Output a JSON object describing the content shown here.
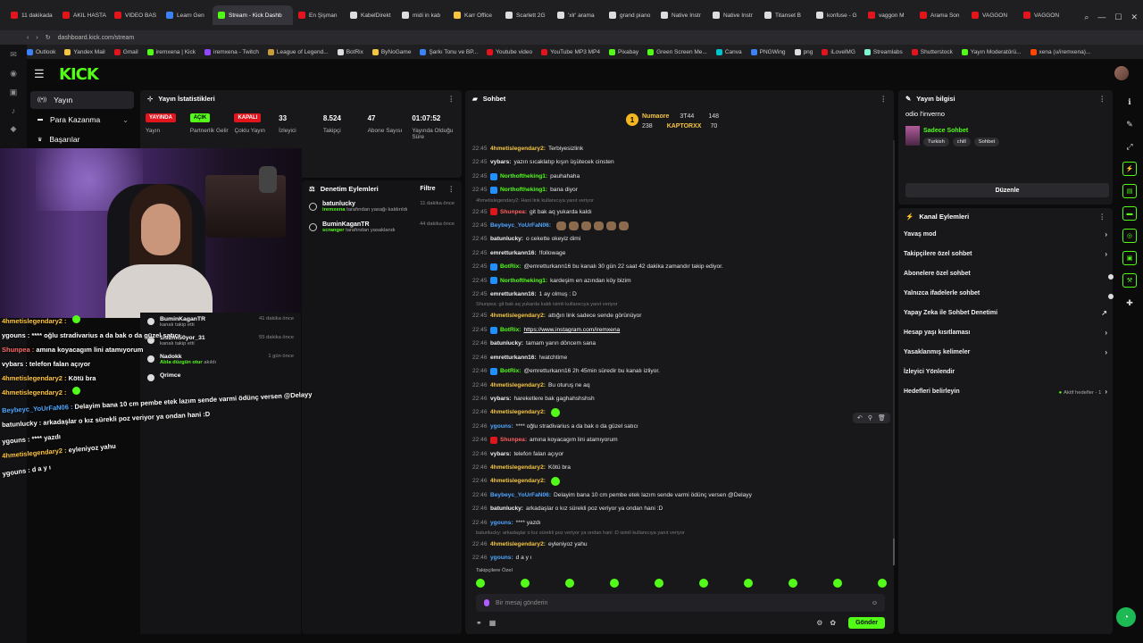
{
  "browser": {
    "tabs": [
      {
        "label": "11 dakikada",
        "color": "#e2141c"
      },
      {
        "label": "AKIL HASTA",
        "color": "#e2141c"
      },
      {
        "label": "VIDEO BAS",
        "color": "#e2141c"
      },
      {
        "label": "Learn Gen",
        "color": "#3b82f6"
      },
      {
        "label": "Stream - Kick Dashb",
        "color": "#53fc18",
        "active": true
      },
      {
        "label": "En Şişman",
        "color": "#e2141c"
      },
      {
        "label": "KabelDirekt",
        "color": "#dddddd"
      },
      {
        "label": "midi in kab",
        "color": "#dddddd"
      },
      {
        "label": "Karr Office",
        "color": "#f5c542"
      },
      {
        "label": "Scarlett 2G",
        "color": "#dddddd"
      },
      {
        "label": "'xlr' arama",
        "color": "#dddddd"
      },
      {
        "label": "grand piano",
        "color": "#dddddd"
      },
      {
        "label": "Native Instr",
        "color": "#dddddd"
      },
      {
        "label": "Native Instr",
        "color": "#dddddd"
      },
      {
        "label": "Titanset B",
        "color": "#dddddd"
      },
      {
        "label": "konfuse - G",
        "color": "#dddddd"
      },
      {
        "label": "vaggon M",
        "color": "#e2141c"
      },
      {
        "label": "Arama Son",
        "color": "#e2141c"
      },
      {
        "label": "VAGGON",
        "color": "#e2141c"
      },
      {
        "label": "VAGGON",
        "color": "#e2141c"
      }
    ],
    "url": "dashboard.kick.com/stream",
    "bookmarks": [
      {
        "label": "Outlook",
        "color": "#3b82f6"
      },
      {
        "label": "Yandex Mail",
        "color": "#f5c542"
      },
      {
        "label": "Gmail",
        "color": "#e2141c"
      },
      {
        "label": "iremxena | Kick",
        "color": "#53fc18"
      },
      {
        "label": "iremxena - Twitch",
        "color": "#9146ff"
      },
      {
        "label": "League of Legend...",
        "color": "#c89b3c"
      },
      {
        "label": "BotRix",
        "color": "#dddddd"
      },
      {
        "label": "ByNoGame",
        "color": "#f5c542"
      },
      {
        "label": "Şarkı Tonu ve BP...",
        "color": "#3b82f6"
      },
      {
        "label": "Youtube video",
        "color": "#e2141c"
      },
      {
        "label": "YouTube MP3 MP4",
        "color": "#e2141c"
      },
      {
        "label": "Pixabay",
        "color": "#53fc18"
      },
      {
        "label": "Green Screen Me...",
        "color": "#53fc18"
      },
      {
        "label": "Canva",
        "color": "#00c4cc"
      },
      {
        "label": "PNGWing",
        "color": "#3b82f6"
      },
      {
        "label": "png",
        "color": "#dddddd"
      },
      {
        "label": "iLovelMG",
        "color": "#e2141c"
      },
      {
        "label": "Streamlabs",
        "color": "#80f5d2"
      },
      {
        "label": "Shutterstock",
        "color": "#e2141c"
      },
      {
        "label": "Yayın Moderatörü...",
        "color": "#53fc18"
      },
      {
        "label": "xena (u/iremxena)...",
        "color": "#ff4500"
      }
    ]
  },
  "kick": {
    "logo": "KICK",
    "nav": [
      {
        "label": "Yayın",
        "icon": "broadcast-icon",
        "active": true
      },
      {
        "label": "Para Kazanma",
        "icon": "money-icon",
        "chevron": "⌄"
      },
      {
        "label": "Başarılar",
        "icon": "trophy-icon"
      }
    ]
  },
  "stats": {
    "title": "Yayın İstatistikleri",
    "items": [
      {
        "badge": "YAYINDA",
        "badgeType": "live",
        "label": "Yayın"
      },
      {
        "badge": "AÇIK",
        "badgeType": "on",
        "label": "Partnerlik Gelir"
      },
      {
        "badge": "KAPALI",
        "badgeType": "off",
        "label": "Çoklu Yayın"
      },
      {
        "value": "33",
        "label": "İzleyici"
      },
      {
        "value": "8.524",
        "label": "Takipçi"
      },
      {
        "value": "47",
        "label": "Abone Sayısı"
      },
      {
        "value": "01:07:52",
        "label": "Yayında Olduğu Süre"
      }
    ]
  },
  "modActions": {
    "title": "Denetim Eylemleri",
    "filter": "Filtre",
    "items": [
      {
        "user": "batunlucky",
        "actor": "iremxena",
        "action": "tarafından yasağı kaldırıldı",
        "time": "11 dakika önce"
      },
      {
        "user": "BuminKaganTR",
        "actor": "scranger",
        "action": "tarafından yasaklandı",
        "time": "44 dakika önce"
      }
    ]
  },
  "followers": [
    {
      "user": "BuminKaganTR",
      "note": "kanalı takip etti",
      "time": "41 dakika önce"
    },
    {
      "user": "1is2mi50yor_31",
      "note": "kanalı takip etti",
      "time": "55 dakika önce"
    },
    {
      "user": "Nadokk",
      "note_green": "Abla düzgün otur",
      "note": "akıldı",
      "time": "1 gün önce"
    },
    {
      "user": "Qrimce",
      "note": "",
      "time": ""
    }
  ],
  "overlayChat": [
    {
      "user": "4hmetislegendary2 :",
      "text": "",
      "cls": "yellow"
    },
    {
      "user": "ygouns :",
      "text": "**** oğlu stradivarius a da bak o da güzel satıcı",
      "cls": "white"
    },
    {
      "user": "Shunpea :",
      "text": "amına koyacagım lini atamıyorum",
      "cls": "red"
    },
    {
      "user": "vybars :",
      "text": "telefon falan açıyor",
      "cls": "white"
    },
    {
      "user": "4hmetislegendary2 :",
      "text": "Kötü bra",
      "cls": "yellow"
    },
    {
      "user": "4hmetislegendary2 :",
      "text": "",
      "cls": "yellow"
    },
    {
      "user": "Beybeyc_YoUrFaN06 :",
      "text": "Delayim bana 10 cm pembe etek lazım sende varmi ödünç versen @Delayy",
      "cls": "blue"
    },
    {
      "user": "batunlucky :",
      "text": "arkadaşlar o kız sürekli poz veriyor ya ondan hani :D",
      "cls": "white"
    },
    {
      "user": "ygouns :",
      "text": "**** yazdı",
      "cls": "white"
    },
    {
      "user": "4hmetislegendary2 :",
      "text": "eyleniyoz yahu",
      "cls": "yellow"
    },
    {
      "user": "ygouns :",
      "text": "d a y ı",
      "cls": "white"
    }
  ],
  "chat": {
    "title": "Sohbet",
    "pinned": {
      "rank": "1",
      "user1": "Numaore",
      "user1_val": "238",
      "user2_label": "3T44",
      "user2_val": "148",
      "user3": "KAPTORXX",
      "user3_val": "70"
    },
    "messages": [
      {
        "t": "22:45",
        "u": "4hmetislegendary2:",
        "c": "yellow",
        "text": "Terbiyesizlink"
      },
      {
        "t": "22:45",
        "u": "vybars:",
        "c": "white",
        "text": "yazın sıcaklatıp kışın üşütecek cinsten"
      },
      {
        "t": "22:45",
        "u": "Northoftheking1:",
        "c": "green",
        "text": "pauhahaha"
      },
      {
        "t": "22:45",
        "u": "Northoftheking1:",
        "c": "green",
        "text": "bana diyor"
      },
      {
        "reply": "4hmetislegendary2: Hani link kullanıcıya yanıt veriyor"
      },
      {
        "t": "22:45",
        "u": "Shunpea:",
        "c": "red",
        "text": "git bak aq yukarda kaldı"
      },
      {
        "t": "22:45",
        "u": "Beybeyc_YoUrFaN06:",
        "c": "blue",
        "text": "",
        "emotes": 6
      },
      {
        "t": "22:45",
        "u": "batunlucky:",
        "c": "white",
        "text": "o cekette okeyiz dimi"
      },
      {
        "t": "22:45",
        "u": "emretturkann16:",
        "c": "white",
        "text": "!followage"
      },
      {
        "t": "22:45",
        "u": "BotRix:",
        "c": "green",
        "text": "@emretturkann16 bu kanalı 30 gün 22 saat 42 dakika zamandır takip ediyor."
      },
      {
        "t": "22:45",
        "u": "Northoftheking1:",
        "c": "green",
        "text": "kardeşim en azından köy bizim"
      },
      {
        "t": "22:45",
        "u": "emretturkann16:",
        "c": "white",
        "text": "1 ay olmuş : D"
      },
      {
        "reply": "Shunpea: git bak aq yukarda kaldı isimli kullanıcıya yanıt veriyor"
      },
      {
        "t": "22:45",
        "u": "4hmetislegendary2:",
        "c": "yellow",
        "text": "attığın link sadece sende görünüyor"
      },
      {
        "t": "22:45",
        "u": "BotRix:",
        "c": "green",
        "text": "",
        "link": "https://www.instagram.com/iremxena"
      },
      {
        "t": "22:46",
        "u": "batunlucky:",
        "c": "white",
        "text": "tamam yarın döncem sana"
      },
      {
        "t": "22:46",
        "u": "emretturkann16:",
        "c": "white",
        "text": "!watchtime"
      },
      {
        "t": "22:46",
        "u": "BotRix:",
        "c": "green",
        "text": "@emretturkann16 2h 45min süredir bu kanalı izliyor."
      },
      {
        "t": "22:46",
        "u": "4hmetislegendary2:",
        "c": "yellow",
        "text": "Bu oturuş ne aq"
      },
      {
        "t": "22:46",
        "u": "vybars:",
        "c": "white",
        "text": "hareketlere bak gaghahshshsh"
      },
      {
        "t": "22:46",
        "u": "4hmetislegendary2:",
        "c": "yellow",
        "text": "",
        "emotes": 1
      },
      {
        "t": "22:46",
        "u": "ygouns:",
        "c": "blue",
        "text": "**** oğlu stradivarius a da bak o da güzel satıcı"
      },
      {
        "t": "22:46",
        "u": "Shunpea:",
        "c": "red",
        "text": "amına koyacagım lini atamıyorum"
      },
      {
        "t": "22:46",
        "u": "vybars:",
        "c": "white",
        "text": "telefon falan açıyor"
      },
      {
        "t": "22:46",
        "u": "4hmetislegendary2:",
        "c": "yellow",
        "text": "Kötü bra"
      },
      {
        "t": "22:46",
        "u": "4hmetislegendary2:",
        "c": "yellow",
        "text": "",
        "emotes": 1
      },
      {
        "t": "22:46",
        "u": "Beybeyc_YoUrFaN06:",
        "c": "blue",
        "text": "Delayim bana 10 cm pembe etek lazım sende varmi ödünç versen @Delayy"
      },
      {
        "t": "22:46",
        "u": "batunlucky:",
        "c": "white",
        "text": "arkadaşlar o kız sürekli poz veriyor ya ondan hani :D"
      },
      {
        "t": "22:46",
        "u": "ygouns:",
        "c": "blue",
        "text": "**** yazdı"
      },
      {
        "reply": "batunlucky: arkadaşlar o kız sürekli poz veriyor ya ondan hani :D isimli kullanıcıya yanıt veriyor"
      },
      {
        "t": "22:46",
        "u": "4hmetislegendary2:",
        "c": "yellow",
        "text": "eyleniyoz yahu"
      },
      {
        "t": "22:46",
        "u": "ygouns:",
        "c": "blue",
        "text": "d a y ı"
      }
    ],
    "followersOnly": "Takipçilere Özel",
    "placeholder": "Bir mesaj gönderin",
    "send": "Gönder"
  },
  "streamInfo": {
    "title": "Yayın bilgisi",
    "streamTitle": "odio l'inverno",
    "category": "Sadece Sohbet",
    "tags": [
      "Turkish",
      "chill",
      "Sohbet"
    ],
    "edit": "Düzenle"
  },
  "channelActions": {
    "title": "Kanal Eylemleri",
    "items": [
      {
        "label": "Yavaş mod",
        "ctrl": "arrow"
      },
      {
        "label": "Takipçilere özel sohbet",
        "ctrl": "arrow"
      },
      {
        "label": "Abonelere özel sohbet",
        "ctrl": "toggle"
      },
      {
        "label": "Yalnızca ifadelerle sohbet",
        "ctrl": "toggle"
      },
      {
        "label": "Yapay Zeka ile Sohbet Denetimi",
        "ctrl": "ext"
      },
      {
        "label": "Hesap yaşı kısıtlaması",
        "ctrl": "arrow"
      },
      {
        "label": "Yasaklanmış kelimeler",
        "ctrl": "arrow"
      },
      {
        "label": "İzleyici Yönlendir",
        "ctrl": "none"
      },
      {
        "label": "Hedefleri belirleyin",
        "ctrl": "arrow",
        "note": "Aktif hedefler - 1"
      }
    ]
  }
}
